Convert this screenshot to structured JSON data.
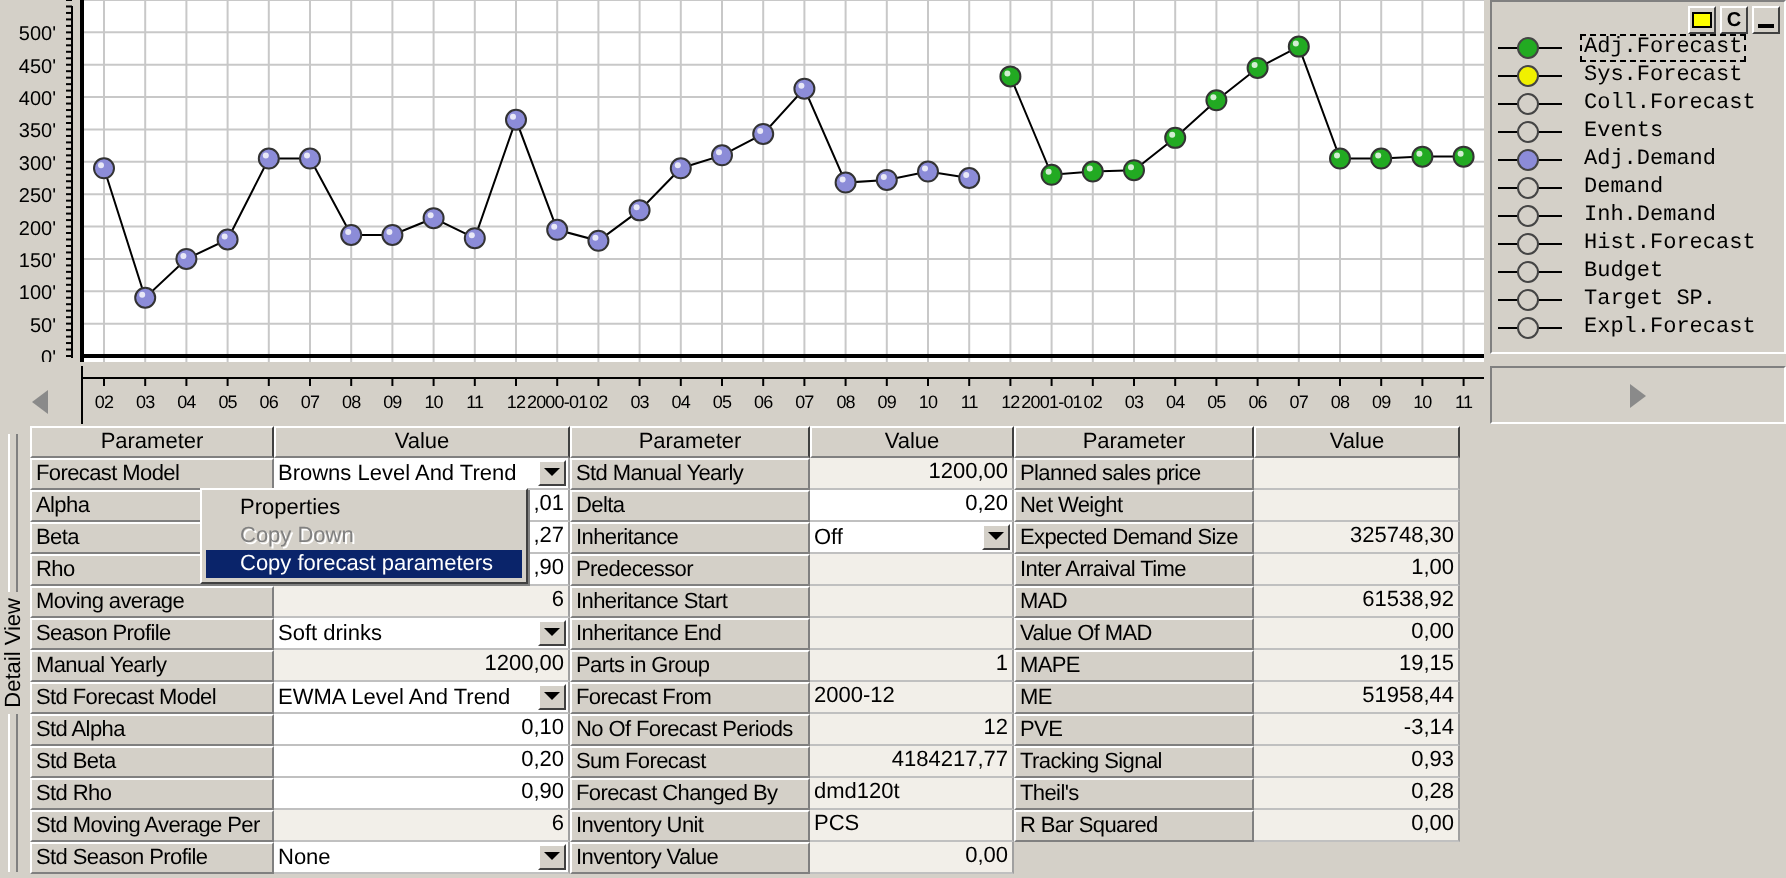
{
  "chart": {
    "chart_data": {
      "type": "line",
      "categories": [
        "02",
        "03",
        "04",
        "05",
        "06",
        "07",
        "08",
        "09",
        "10",
        "11",
        "12",
        "2000-01",
        "02",
        "03",
        "04",
        "05",
        "06",
        "07",
        "08",
        "09",
        "10",
        "11",
        "12",
        "2001-01",
        "02",
        "03",
        "04",
        "05",
        "06",
        "07",
        "08",
        "09",
        "10",
        "11"
      ],
      "ylim": [
        0,
        550
      ],
      "grid": true,
      "yticks": [
        {
          "value": 0,
          "label": "0'"
        },
        {
          "value": 50,
          "label": "50'"
        },
        {
          "value": 100,
          "label": "100'"
        },
        {
          "value": 150,
          "label": "150'"
        },
        {
          "value": 200,
          "label": "200'"
        },
        {
          "value": 250,
          "label": "250'"
        },
        {
          "value": 300,
          "label": "300'"
        },
        {
          "value": 350,
          "label": "350'"
        },
        {
          "value": 400,
          "label": "400'"
        },
        {
          "value": 450,
          "label": "450'"
        },
        {
          "value": 500,
          "label": "500'"
        }
      ],
      "series": [
        {
          "color": "#8c8cd8",
          "marker": "circle",
          "values": [
            290,
            90,
            150,
            180,
            305,
            305,
            187,
            187,
            213,
            182,
            365,
            195,
            178,
            225,
            290,
            310,
            343,
            413,
            268,
            272,
            285,
            275,
            null,
            null,
            null,
            null,
            null,
            null,
            null,
            null,
            null,
            null,
            null,
            null
          ]
        },
        {
          "color": "#22aa22",
          "marker": "circle",
          "values": [
            null,
            null,
            null,
            null,
            null,
            null,
            null,
            null,
            null,
            null,
            null,
            null,
            null,
            null,
            null,
            null,
            null,
            null,
            null,
            null,
            null,
            null,
            432,
            280,
            285,
            287,
            337,
            395,
            445,
            478,
            305,
            305,
            308,
            308
          ]
        }
      ]
    }
  },
  "legend": {
    "buttons": [
      {
        "kind": "color"
      },
      {
        "kind": "text",
        "label": "C"
      },
      {
        "kind": "minimize"
      }
    ],
    "items": [
      {
        "label": "Adj.Forecast",
        "color": "#22aa22",
        "selected": true
      },
      {
        "label": "Sys.Forecast",
        "color": "#f0f000",
        "selected": false
      },
      {
        "label": "Coll.Forecast",
        "color": "#d4d0c8",
        "selected": false
      },
      {
        "label": "Events",
        "color": "#d4d0c8",
        "selected": false
      },
      {
        "label": "Adj.Demand",
        "color": "#8c8cd8",
        "selected": false
      },
      {
        "label": "Demand",
        "color": "#d4d0c8",
        "selected": false
      },
      {
        "label": "Inh.Demand",
        "color": "#d4d0c8",
        "selected": false
      },
      {
        "label": "Hist.Forecast",
        "color": "#d4d0c8",
        "selected": false
      },
      {
        "label": "Budget",
        "color": "#d4d0c8",
        "selected": false
      },
      {
        "label": "Target SP.",
        "color": "#d4d0c8",
        "selected": false
      },
      {
        "label": "Expl.Forecast",
        "color": "#d4d0c8",
        "selected": false
      }
    ]
  },
  "detail_view": {
    "title": "Detail View"
  },
  "grid": {
    "headers": [
      "Parameter",
      "Value",
      "Parameter",
      "Value",
      "Parameter",
      "Value"
    ],
    "groups": [
      {
        "rows": [
          {
            "parameter": "Forecast Model",
            "value": "Browns Level And Trend",
            "kind": "dropdown",
            "editable": true
          },
          {
            "parameter": "Alpha",
            "value": ",01",
            "kind": "number",
            "editable": true
          },
          {
            "parameter": "Beta",
            "value": ",27",
            "kind": "number",
            "editable": true
          },
          {
            "parameter": "Rho",
            "value": ",90",
            "kind": "number",
            "editable": true
          },
          {
            "parameter": "Moving average",
            "value": "6",
            "kind": "number",
            "editable": false
          },
          {
            "parameter": "Season Profile",
            "value": "Soft drinks",
            "kind": "dropdown",
            "editable": true
          },
          {
            "parameter": "Manual Yearly",
            "value": "1200,00",
            "kind": "number",
            "editable": false
          },
          {
            "parameter": "Std Forecast Model",
            "value": "EWMA Level And Trend",
            "kind": "dropdown",
            "editable": true
          },
          {
            "parameter": "Std Alpha",
            "value": "0,10",
            "kind": "number",
            "editable": true
          },
          {
            "parameter": "Std Beta",
            "value": "0,20",
            "kind": "number",
            "editable": true
          },
          {
            "parameter": "Std Rho",
            "value": "0,90",
            "kind": "number",
            "editable": true
          },
          {
            "parameter": "Std Moving Average Per",
            "value": "6",
            "kind": "number",
            "editable": false
          },
          {
            "parameter": "Std Season Profile",
            "value": "None",
            "kind": "dropdown",
            "editable": true
          }
        ]
      },
      {
        "rows": [
          {
            "parameter": "Std Manual Yearly",
            "value": "1200,00",
            "kind": "number",
            "editable": false
          },
          {
            "parameter": "Delta",
            "value": "0,20",
            "kind": "number",
            "editable": true
          },
          {
            "parameter": "Inheritance",
            "value": "Off",
            "kind": "dropdown",
            "editable": true
          },
          {
            "parameter": "Predecessor",
            "kind": "text",
            "editable": false
          },
          {
            "parameter": "Inheritance Start",
            "kind": "text",
            "editable": false
          },
          {
            "parameter": "Inheritance End",
            "kind": "text",
            "editable": false
          },
          {
            "parameter": "Parts in Group",
            "value": "1",
            "kind": "number",
            "editable": false
          },
          {
            "parameter": "Forecast From",
            "value": "2000-12",
            "kind": "text",
            "editable": false
          },
          {
            "parameter": "No Of Forecast Periods",
            "value": "12",
            "kind": "number",
            "editable": false
          },
          {
            "parameter": "Sum Forecast",
            "value": "4184217,77",
            "kind": "number",
            "editable": false
          },
          {
            "parameter": "Forecast Changed By",
            "value": "dmd120t",
            "kind": "text",
            "editable": false
          },
          {
            "parameter": "Inventory Unit",
            "value": "PCS",
            "kind": "text",
            "editable": false
          },
          {
            "parameter": "Inventory Value",
            "value": "0,00",
            "kind": "number",
            "editable": false
          }
        ]
      },
      {
        "rows": [
          {
            "parameter": "Planned sales price",
            "kind": "number",
            "editable": false
          },
          {
            "parameter": "Net Weight",
            "kind": "number",
            "editable": false
          },
          {
            "parameter": "Expected Demand Size",
            "value": "325748,30",
            "kind": "number",
            "editable": false
          },
          {
            "parameter": "Inter Arraival Time",
            "value": "1,00",
            "kind": "number",
            "editable": false
          },
          {
            "parameter": "MAD",
            "value": "61538,92",
            "kind": "number",
            "editable": false
          },
          {
            "parameter": "Value Of MAD",
            "value": "0,00",
            "kind": "number",
            "editable": false
          },
          {
            "parameter": "MAPE",
            "value": "19,15",
            "kind": "number",
            "editable": false
          },
          {
            "parameter": "ME",
            "value": "51958,44",
            "kind": "number",
            "editable": false
          },
          {
            "parameter": "PVE",
            "value": "-3,14",
            "kind": "number",
            "editable": false
          },
          {
            "parameter": "Tracking Signal",
            "value": "0,93",
            "kind": "number",
            "editable": false
          },
          {
            "parameter": "Theil's",
            "value": "0,28",
            "kind": "number",
            "editable": false
          },
          {
            "parameter": "R Bar Squared",
            "value": "0,00",
            "kind": "number",
            "editable": false
          }
        ]
      }
    ]
  },
  "context_menu": {
    "items": [
      {
        "label": "Properties",
        "disabled": false,
        "selected": false
      },
      {
        "label": "Copy Down",
        "disabled": true,
        "selected": false
      },
      {
        "label": "Copy forecast parameters",
        "disabled": false,
        "selected": true
      }
    ]
  }
}
